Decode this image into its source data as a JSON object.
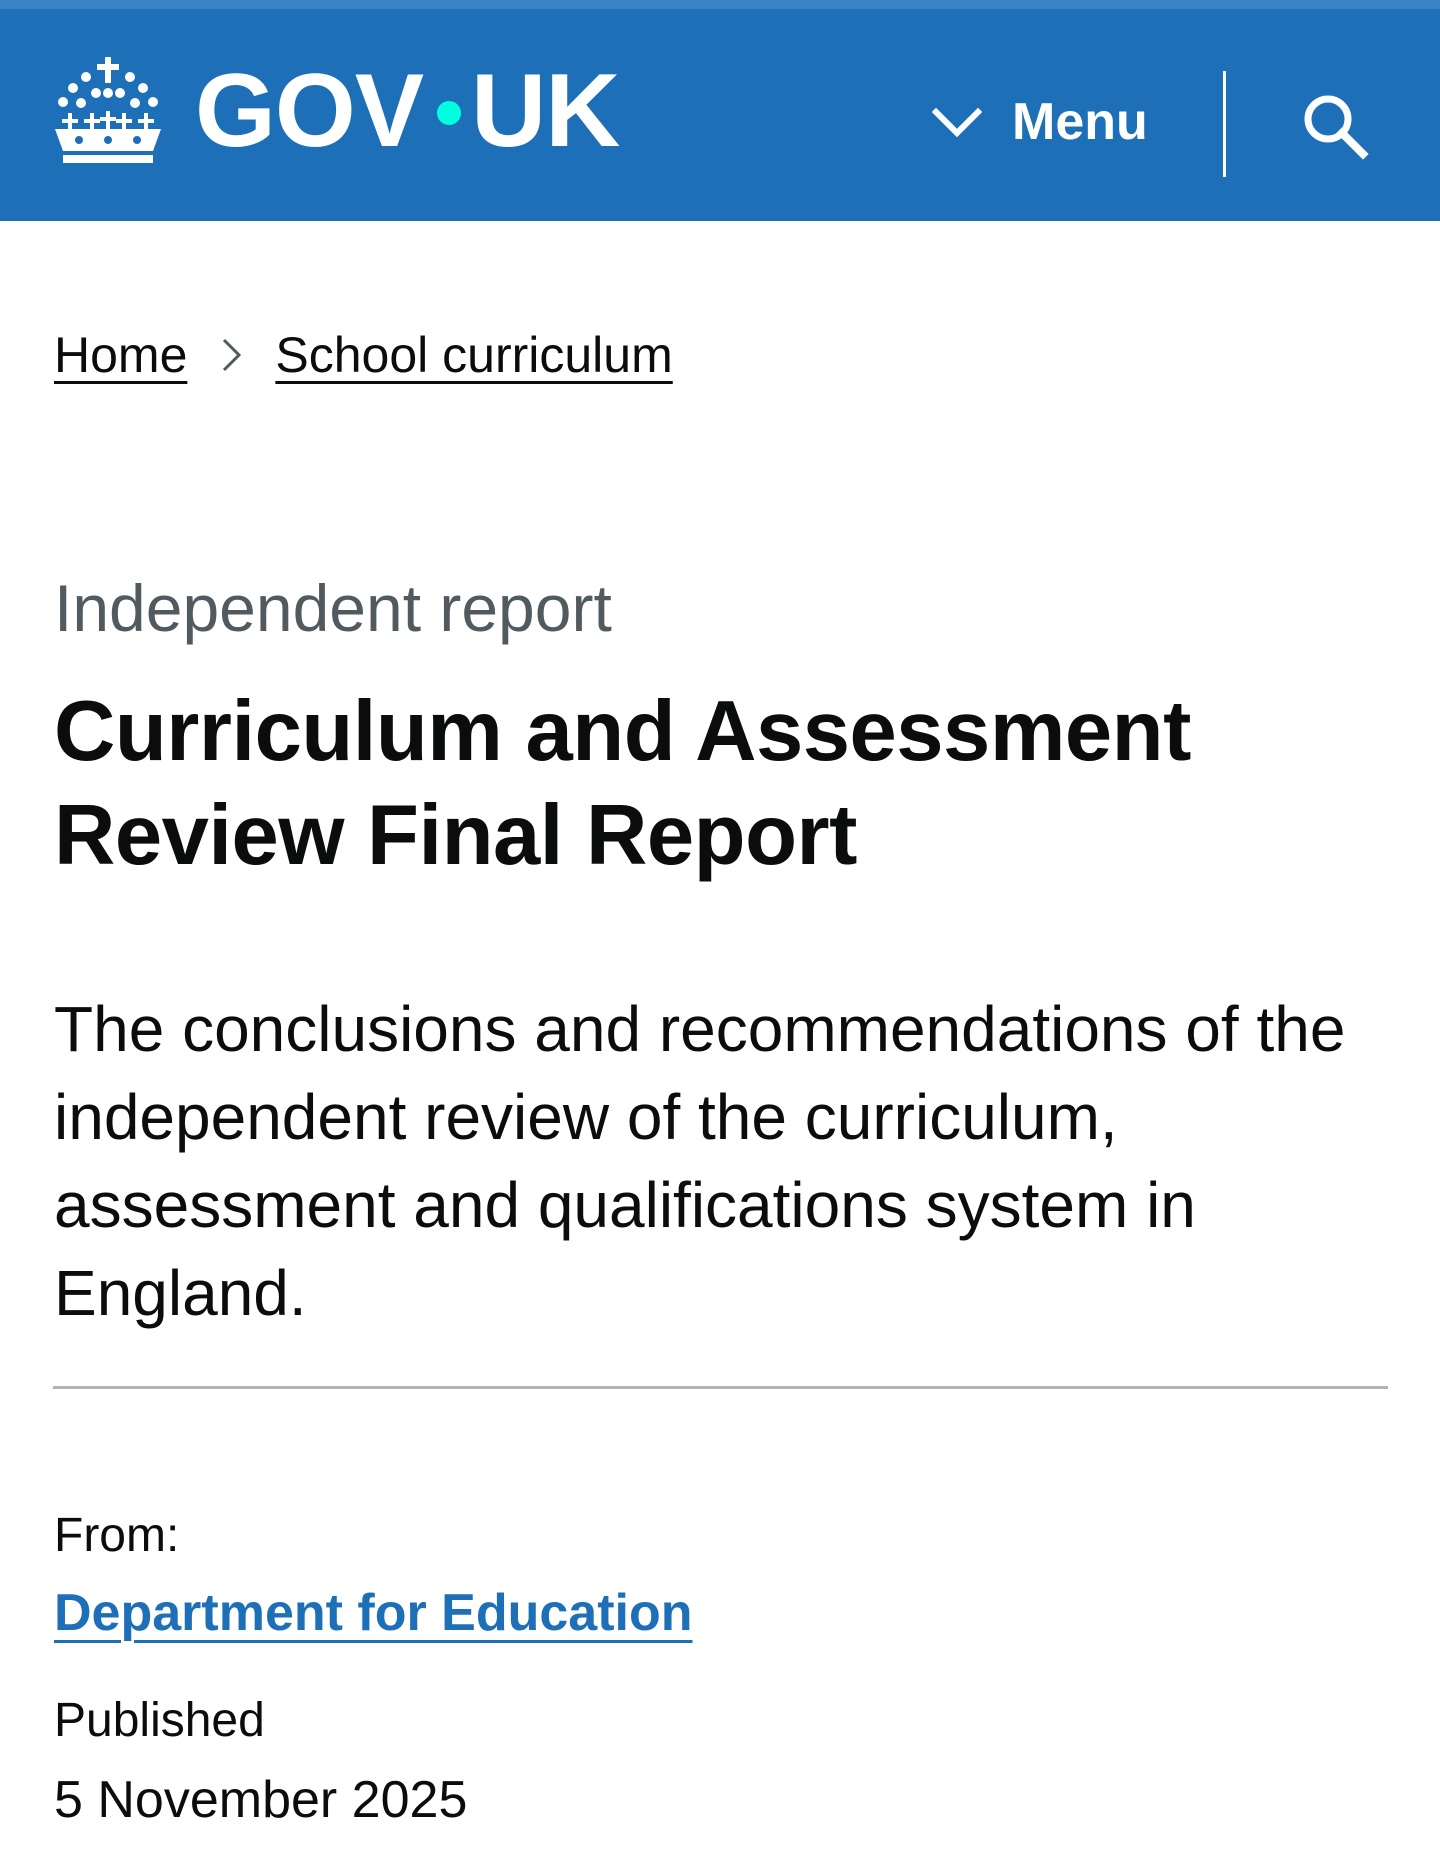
{
  "header": {
    "logo_text_left": "GOV",
    "logo_text_right": "UK",
    "menu_label": "Menu",
    "background_color": "#1d70b8",
    "dot_color": "#00ffe0",
    "icons": [
      "crown-icon",
      "chevron-down-icon",
      "search-icon"
    ]
  },
  "breadcrumb": {
    "items": [
      {
        "label": "Home"
      },
      {
        "label": "School curriculum"
      }
    ]
  },
  "document": {
    "caption": "Independent report",
    "title": "Curriculum and Assessment Review Final Report",
    "lead": "The conclusions and recommendations of the independent review of the curriculum, assessment and qualifications system in England."
  },
  "metadata": {
    "from_label": "From:",
    "organisation": "Department for Education",
    "published_label": "Published",
    "published_date": "5 November 2025",
    "link_color": "#1d70b8"
  }
}
